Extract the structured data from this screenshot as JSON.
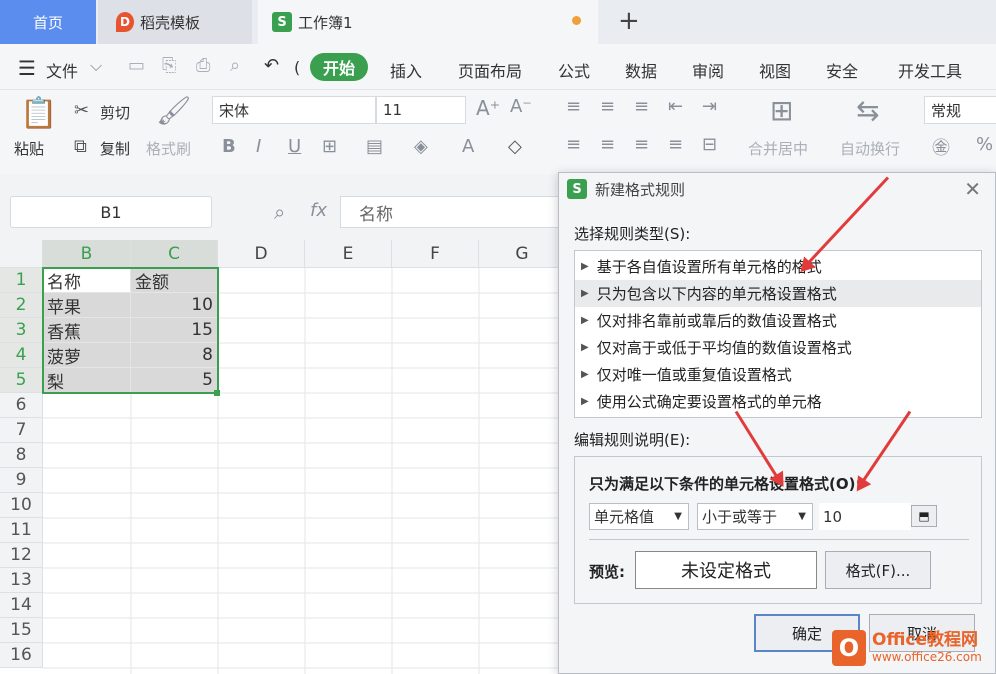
{
  "tabs": {
    "home": "首页",
    "daoke": "稻壳模板",
    "book": "工作簿1",
    "daoke_logo": "D",
    "book_logo": "S",
    "new_tab": "+"
  },
  "menu": {
    "file": "文件",
    "items": [
      "插入",
      "页面布局",
      "公式",
      "数据",
      "审阅",
      "视图",
      "安全",
      "开发工具"
    ],
    "start": "开始"
  },
  "ribbon": {
    "paste": "粘贴",
    "cut": "剪切",
    "copy": "复制",
    "format_painter": "格式刷",
    "font_name": "宋体",
    "font_size": "11",
    "merge": "合并居中",
    "wrap": "自动换行",
    "number_format": "常规"
  },
  "formula_bar": {
    "name_box": "B1",
    "fx": "fx",
    "content": "名称"
  },
  "sheet": {
    "columns": [
      "B",
      "C",
      "D",
      "E",
      "F",
      "G"
    ],
    "rows": [
      "1",
      "2",
      "3",
      "4",
      "5",
      "6",
      "7",
      "8",
      "9",
      "10",
      "11",
      "12",
      "13",
      "14",
      "15",
      "16"
    ],
    "data": [
      [
        "名称",
        "金额"
      ],
      [
        "苹果",
        "10"
      ],
      [
        "香蕉",
        "15"
      ],
      [
        "菠萝",
        "8"
      ],
      [
        "梨",
        "5"
      ]
    ]
  },
  "dialog": {
    "title": "新建格式规则",
    "select_type_label": "选择规则类型(S):",
    "rules": [
      "基于各自值设置所有单元格的格式",
      "只为包含以下内容的单元格设置格式",
      "仅对排名靠前或靠后的数值设置格式",
      "仅对高于或低于平均值的数值设置格式",
      "仅对唯一值或重复值设置格式",
      "使用公式确定要设置格式的单元格"
    ],
    "edit_label": "编辑规则说明(E):",
    "condition_label": "只为满足以下条件的单元格设置格式(O):",
    "cond_type": "单元格值",
    "operator": "小于或等于",
    "value": "10",
    "preview_label": "预览:",
    "preview_text": "未设定格式",
    "format_button": "格式(F)...",
    "ok": "确定",
    "cancel": "取消"
  },
  "watermark": {
    "line1": "Office教程网",
    "line2": "www.office26.com"
  }
}
